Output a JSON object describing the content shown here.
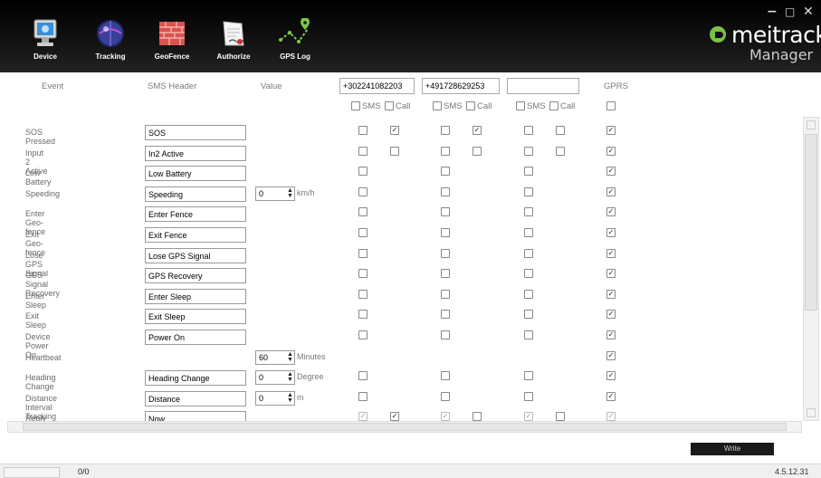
{
  "window": {
    "min": "−",
    "max": "□",
    "close": "✕"
  },
  "toolbar": [
    {
      "label": "Device",
      "icon": "monitor-icon"
    },
    {
      "label": "Tracking",
      "icon": "globe-icon"
    },
    {
      "label": "GeoFence",
      "icon": "firewall-icon"
    },
    {
      "label": "Authorize",
      "icon": "document-icon"
    },
    {
      "label": "GPS Log",
      "icon": "route-icon"
    }
  ],
  "brand": {
    "name": "meitrack",
    "sub": "Manager"
  },
  "headers": {
    "event": "Event",
    "sms_header": "SMS Header",
    "value": "Value",
    "gprs": "GPRS"
  },
  "phones": [
    "+302241082203",
    "+491728629253",
    ""
  ],
  "check_labels": {
    "sms": "SMS",
    "call": "Call"
  },
  "rows": [
    {
      "event": "SOS Pressed",
      "sms": "SOS"
    },
    {
      "event": "Input 2 Active",
      "sms": "In2 Active"
    },
    {
      "event": "Low Battery",
      "sms": "Low Battery"
    },
    {
      "event": "Speeding",
      "sms": "Speeding",
      "value": "0",
      "unit": "km/h"
    },
    {
      "event": "Enter Geo-fence",
      "sms": "Enter Fence"
    },
    {
      "event": "Exit Geo-fence",
      "sms": "Exit Fence"
    },
    {
      "event": "Lose GPS Signal",
      "sms": "Lose GPS Signal"
    },
    {
      "event": "GPS Signal Recovery",
      "sms": "GPS Recovery"
    },
    {
      "event": "Enter Sleep",
      "sms": "Enter Sleep"
    },
    {
      "event": "Exit Sleep",
      "sms": "Exit Sleep"
    },
    {
      "event": "Device Power On",
      "sms": "Power On"
    },
    {
      "event": "Heartbeat",
      "value": "60",
      "unit": "Minutes"
    },
    {
      "event": "Heading Change",
      "sms": "Heading Change",
      "value": "0",
      "unit": "Degree"
    },
    {
      "event": "Distance Interval Tracking",
      "sms": "Distance",
      "value": "0",
      "unit": "m"
    },
    {
      "event": "Reply Location(Passive)",
      "sms": "Now"
    }
  ],
  "write_label": "Write",
  "status": {
    "count": "0/0",
    "version": "4.5.12.31"
  }
}
